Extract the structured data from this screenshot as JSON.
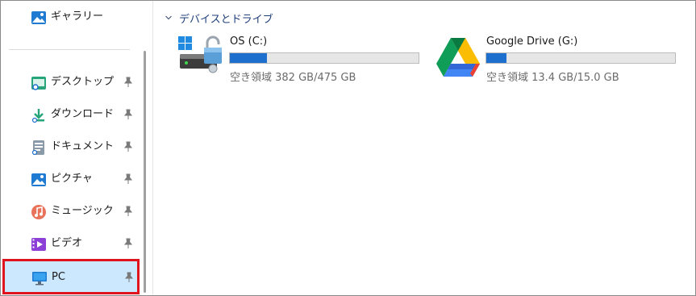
{
  "sidebar": {
    "gallery_label": "ギャラリー",
    "items": [
      {
        "label": "デスクトップ",
        "icon": "desktop-folder-icon"
      },
      {
        "label": "ダウンロード",
        "icon": "download-folder-icon"
      },
      {
        "label": "ドキュメント",
        "icon": "documents-folder-icon"
      },
      {
        "label": "ピクチャ",
        "icon": "pictures-folder-icon"
      },
      {
        "label": "ミュージック",
        "icon": "music-folder-icon"
      },
      {
        "label": "ビデオ",
        "icon": "videos-folder-icon"
      },
      {
        "label": "PC",
        "icon": "pc-monitor-icon"
      }
    ]
  },
  "main": {
    "section_title": "デバイスとドライブ",
    "drives": [
      {
        "name": "OS (C:)",
        "free_text": "空き領域 382 GB/475 GB",
        "used_fraction": 0.196,
        "icon": "windows-locked-drive-icon"
      },
      {
        "name": "Google Drive (G:)",
        "free_text": "空き領域 13.4 GB/15.0 GB",
        "used_fraction": 0.107,
        "icon": "google-drive-icon"
      }
    ]
  },
  "colors": {
    "selection_bg": "#cce8ff",
    "highlight_border": "#e0141e",
    "bar_fill": "#1f6fcf"
  }
}
